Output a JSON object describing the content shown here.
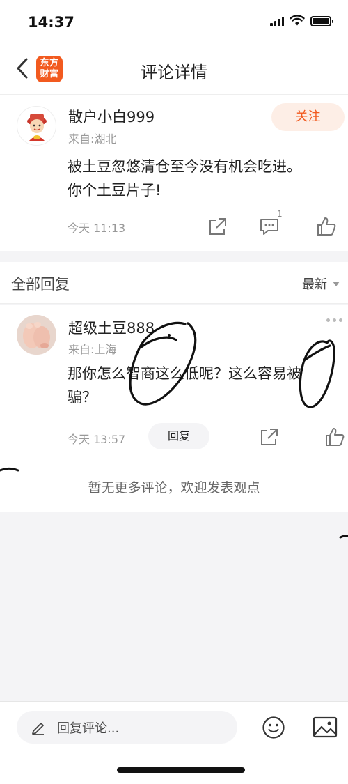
{
  "status_bar": {
    "time": "14:37",
    "battery_level": 1.0
  },
  "nav": {
    "logo_line1": "东方",
    "logo_line2": "财富",
    "title": "评论详情"
  },
  "comment": {
    "username": "散户小白999",
    "location": "来自:湖北",
    "follow_label": "关注",
    "text_line1": "被土豆忽悠清仓至今没有机会吃进。",
    "text_line2": "你个土豆片子!",
    "time": "今天 11:13",
    "reply_count": "1"
  },
  "replies": {
    "title": "全部回复",
    "sort_label": "最新",
    "items": [
      {
        "username": "超级土豆888",
        "location": "来自:上海",
        "text_line1": "那你怎么智商这么低呢？这么容易被",
        "text_line2": "骗？",
        "time": "今天 13:57",
        "reply_label": "回复"
      }
    ],
    "no_more_text": "暂无更多评论，欢迎发表观点"
  },
  "input_bar": {
    "placeholder": "回复评论..."
  },
  "colors": {
    "accent": "#f25a1f",
    "follow_bg": "#fdeee6",
    "page_bg": "#f4f4f6"
  },
  "icons": [
    "back-icon",
    "share-icon",
    "comment-icon",
    "like-icon",
    "more-icon",
    "pencil-icon",
    "emoji-icon",
    "image-icon"
  ]
}
